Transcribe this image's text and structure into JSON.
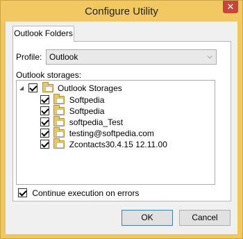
{
  "window": {
    "title": "Configure Utility",
    "close_glyph": "✕"
  },
  "tabs": [
    {
      "label": "Outlook Folders",
      "selected": true
    }
  ],
  "profile": {
    "label": "Profile:",
    "value": "Outlook"
  },
  "storages": {
    "label": "Outlook storages:",
    "root": {
      "label": "Outlook Storages",
      "checked": true,
      "expanded": true
    },
    "items": [
      {
        "label": "Softpedia",
        "checked": true
      },
      {
        "label": "Softpedia",
        "checked": true
      },
      {
        "label": "softpedia_Test",
        "checked": true
      },
      {
        "label": "testing@softpedia.com",
        "checked": true
      },
      {
        "label": "Zcontacts30.4.15 12.11.00",
        "checked": true
      }
    ]
  },
  "options": {
    "continue_on_errors": {
      "label": "Continue execution on errors",
      "checked": true
    }
  },
  "buttons": {
    "ok": "OK",
    "cancel": "Cancel"
  },
  "icons": {
    "tree_expander": "triangle-down-icon",
    "tree_folder": "folder-icon",
    "select_chevron": "chevron-down-icon"
  }
}
